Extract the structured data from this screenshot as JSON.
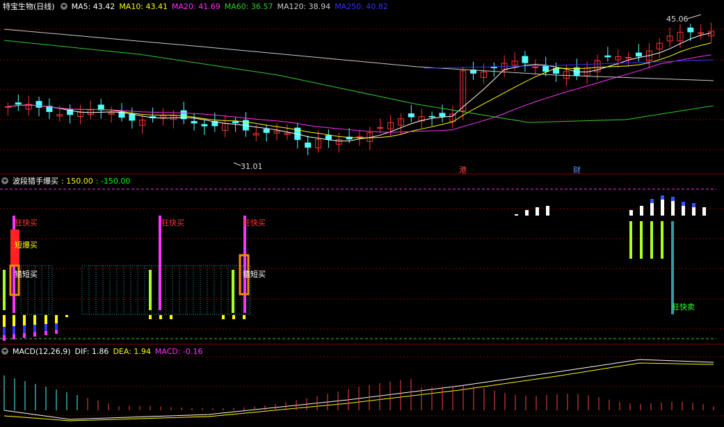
{
  "main_panel": {
    "stock_title": "特宝生物(日线)",
    "ma_items": [
      {
        "label": "MA5: 43.42",
        "color": "#ffffff"
      },
      {
        "label": "MA10: 43.41",
        "color": "#ffff00"
      },
      {
        "label": "MA20: 41.69",
        "color": "#ff33ff"
      },
      {
        "label": "MA60: 36.57",
        "color": "#33cc33"
      },
      {
        "label": "MA120: 38.94",
        "color": "#cccccc"
      },
      {
        "label": "MA250: 40.82",
        "color": "#3333ff"
      }
    ],
    "high_marker": "45.06",
    "low_marker": "31.01",
    "event_tags": [
      {
        "text": "港",
        "color": "#ff4444"
      },
      {
        "text": "财",
        "color": "#5599ff"
      }
    ]
  },
  "indicator_panel": {
    "title": "波段猎手爆买",
    "values": [
      {
        "label": ": 150.00",
        "color": "#ffff00"
      },
      {
        "label": ": -150.00",
        "color": "#00ff00"
      }
    ],
    "signal_labels": [
      {
        "text": "狂快买",
        "color": "#ff3333"
      },
      {
        "text": "短爆买",
        "color": "#ffff00"
      },
      {
        "text": "猎短买",
        "color": "#ffffff"
      },
      {
        "text": "狂快买",
        "color": "#ff3333"
      },
      {
        "text": "狂快买",
        "color": "#ff3333"
      },
      {
        "text": "猎短买",
        "color": "#ffffff"
      },
      {
        "text": "狂快卖",
        "color": "#33ff33"
      }
    ]
  },
  "macd_panel": {
    "title": "MACD(12,26,9)",
    "dif": "DIF: 1.86",
    "dea": "DEA: 1.94",
    "macd": "MACD: -0.16"
  },
  "colors": {
    "up": "#ff3333",
    "down": "#54ffff",
    "grid": "#8b0000",
    "ma5": "#ffffff",
    "ma10": "#ffff00",
    "ma20": "#ff33ff",
    "ma60": "#33cc33",
    "ma120": "#cccccc",
    "ma250": "#3333ff"
  }
}
